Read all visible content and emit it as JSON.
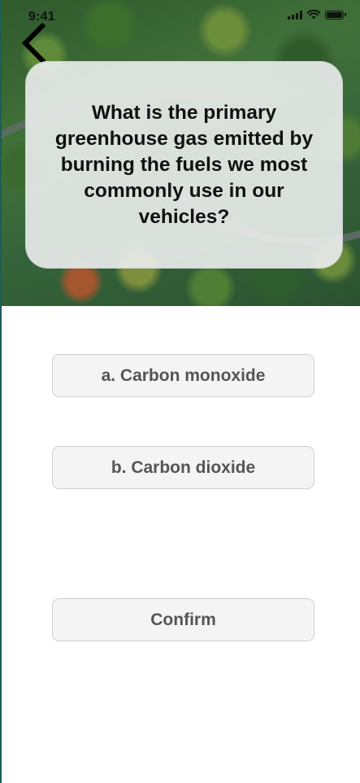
{
  "status_bar": {
    "time": "9:41"
  },
  "header": {
    "back_icon": "chevron-left-icon"
  },
  "question": {
    "text": "What is the primary greenhouse gas emitted by burning the fuels we most commonly use in our vehicles?"
  },
  "options": [
    {
      "label": "a. Carbon monoxide"
    },
    {
      "label": "b. Carbon dioxide"
    }
  ],
  "actions": {
    "confirm_label": "Confirm"
  },
  "colors": {
    "card_background": "#eceeee",
    "button_background": "#f4f4f4",
    "button_text": "#555555",
    "question_text": "#111111"
  }
}
